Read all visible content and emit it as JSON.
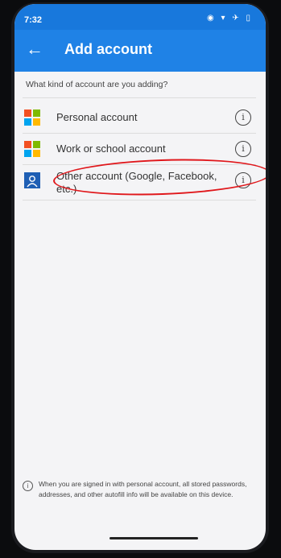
{
  "status_bar": {
    "time": "7:32",
    "icons": "◉ ▾ ✈ ▯"
  },
  "app_bar": {
    "back_icon": "←",
    "title": "Add account"
  },
  "question": "What kind of account are you adding?",
  "accounts": [
    {
      "label": "Personal account",
      "logo": "microsoft-logo"
    },
    {
      "label": "Work or school account",
      "logo": "microsoft-logo"
    },
    {
      "label": "Other account (Google, Facebook, etc.)",
      "logo": "person-logo"
    }
  ],
  "info_glyph": "i",
  "footer": {
    "icon": "i",
    "text": "When you are signed in with personal account, all stored passwords, addresses, and other autofill info will be available on this device."
  },
  "colors": {
    "app_bar": "#1f82e6",
    "highlight": "#e0171b",
    "ms_red": "#f25022",
    "ms_green": "#7fba00",
    "ms_blue": "#00a4ef",
    "ms_yellow": "#ffb900"
  }
}
